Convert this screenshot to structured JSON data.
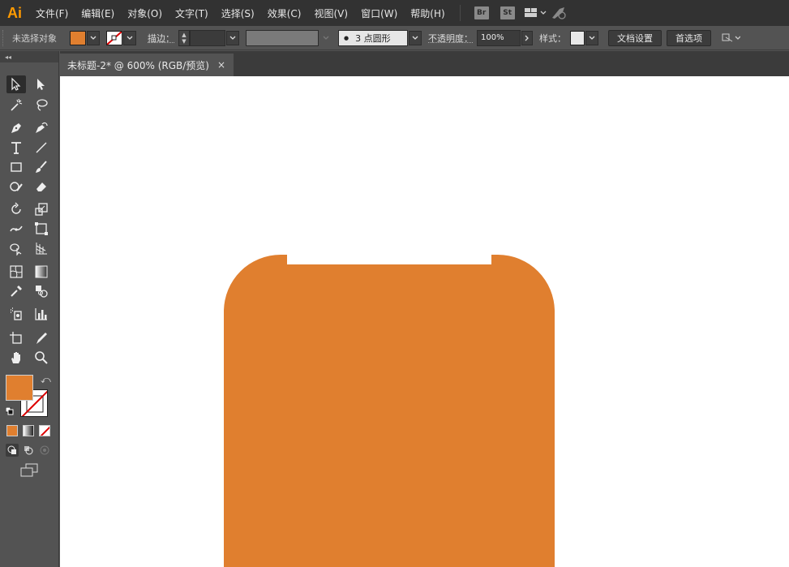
{
  "app": {
    "logo": "Ai"
  },
  "menu": {
    "items": [
      "文件(F)",
      "编辑(E)",
      "对象(O)",
      "文字(T)",
      "选择(S)",
      "效果(C)",
      "视图(V)",
      "窗口(W)",
      "帮助(H)"
    ],
    "bridge_badge": "Br",
    "stock_badge": "St"
  },
  "control": {
    "selection_status": "未选择对象",
    "stroke_label": "描边：",
    "brush_value": "3 点圆形",
    "opacity_label": "不透明度：",
    "opacity_value": "100%",
    "style_label": "样式：",
    "doc_setup_button": "文档设置",
    "preferences_button": "首选项"
  },
  "tab": {
    "title": "未标题-2* @ 600% (RGB/预览)",
    "close": "×"
  },
  "colors": {
    "fill": "#e07f2f",
    "artwork": "#e07f2f",
    "ui_dark": "#323232",
    "ui_panel": "#535353"
  },
  "icons": [
    "selection-tool-icon",
    "direct-selection-tool-icon",
    "magic-wand-tool-icon",
    "lasso-tool-icon",
    "pen-tool-icon",
    "curvature-tool-icon",
    "type-tool-icon",
    "line-tool-icon",
    "rectangle-tool-icon",
    "paintbrush-tool-icon",
    "shaper-tool-icon",
    "eraser-tool-icon",
    "rotate-tool-icon",
    "scale-tool-icon",
    "width-tool-icon",
    "free-transform-tool-icon",
    "shape-builder-tool-icon",
    "perspective-grid-tool-icon",
    "mesh-tool-icon",
    "gradient-tool-icon",
    "eyedropper-tool-icon",
    "blend-tool-icon",
    "symbol-sprayer-tool-icon",
    "column-graph-tool-icon",
    "artboard-tool-icon",
    "slice-tool-icon",
    "hand-tool-icon",
    "zoom-tool-icon"
  ]
}
